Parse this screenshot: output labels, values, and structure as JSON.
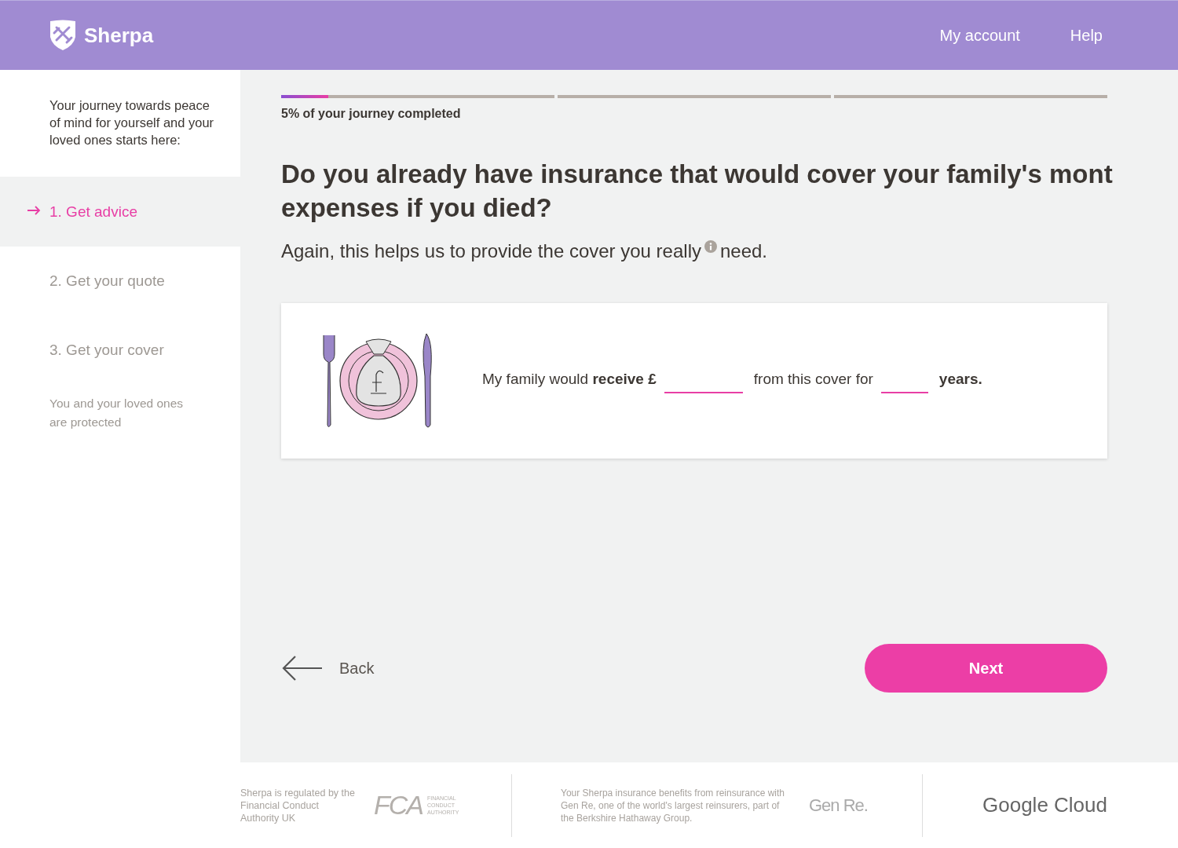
{
  "header": {
    "brand": "Sherpa",
    "nav": [
      {
        "label": "My account"
      },
      {
        "label": "Help"
      }
    ]
  },
  "sidebar": {
    "intro": "Your journey towards peace of mind for yourself and your loved ones starts here:",
    "steps": [
      {
        "label": "1. Get advice",
        "selected": true,
        "kind": "step"
      },
      {
        "label": "2. Get your quote",
        "selected": false,
        "kind": "step"
      },
      {
        "label": "3. Get your cover",
        "selected": false,
        "kind": "step"
      },
      {
        "label": "You and your loved ones are protected",
        "selected": false,
        "kind": "final"
      }
    ]
  },
  "progress": {
    "level": 0.057,
    "caption": "5% of your journey completed"
  },
  "question": {
    "heading_lines": [
      "Do you already have insurance that would cover your family's mont",
      "expenses if you died?"
    ],
    "subtitle": "Again, this helps us to provide the cover you really",
    "subtitle_end": "need."
  },
  "card": {
    "parts": [
      {
        "kind": "text",
        "text": "My family would **receive £**"
      },
      {
        "kind": "wide_field"
      },
      {
        "kind": "text",
        "text": "from this cover for"
      },
      {
        "kind": "narrow_field"
      },
      {
        "kind": "text",
        "text": "**years.**"
      }
    ]
  },
  "actions": {
    "back": "Back",
    "next": "Next"
  },
  "footer": {
    "regulated": "Sherpa is regulated by the Financial Conduct Authority UK",
    "fca_mark": "FCA",
    "fca_words": "FINANCIAL CONDUCT AUTHORITY",
    "reinsurance": "Your Sherpa insurance benefits from reinsurance with Gen Re, one of the world's largest reinsurers, part of the Berkshire Hathaway Group.",
    "genre_mark": "Gen Re.",
    "google_mark": "Google Cloud"
  }
}
